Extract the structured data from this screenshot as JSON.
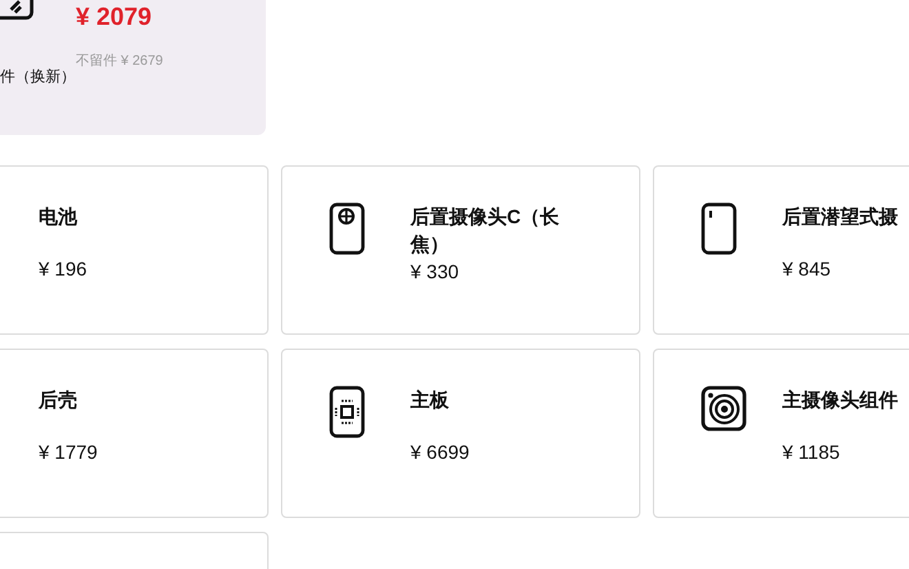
{
  "top_card": {
    "label": "件（换新）",
    "price": "¥ 2079",
    "original_price": "不留件 ¥ 2679"
  },
  "parts": [
    {
      "name": "电池",
      "price": "¥ 196"
    },
    {
      "name": "后置摄像头C（长焦）",
      "price": "¥ 330"
    },
    {
      "name": "后置潜望式摄",
      "price": "¥ 845"
    },
    {
      "name": "后壳",
      "price": "¥ 1779"
    },
    {
      "name": "主板",
      "price": "¥ 6699"
    },
    {
      "name": "主摄像头组件",
      "price": "¥ 1185"
    },
    {
      "kind": "blank"
    }
  ]
}
